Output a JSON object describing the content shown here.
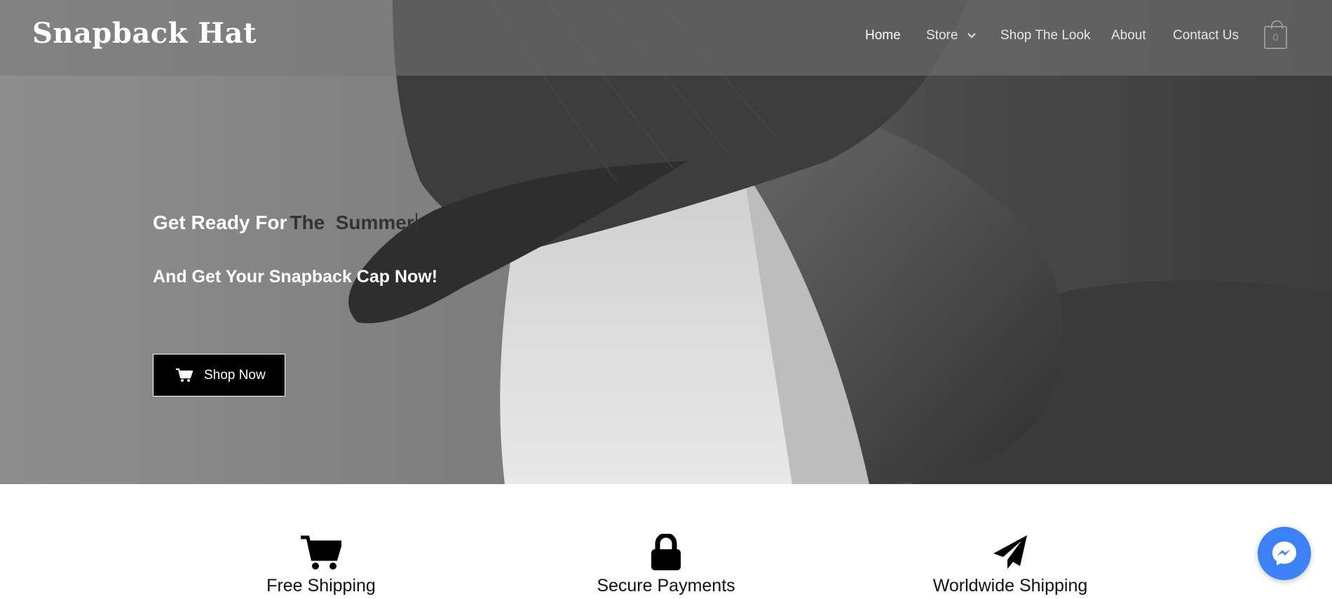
{
  "site": {
    "logo": "Snapback Hat"
  },
  "nav": {
    "items": [
      {
        "label": "Home",
        "active": true
      },
      {
        "label": "Store",
        "has_dropdown": true
      },
      {
        "label": "Shop The Look"
      },
      {
        "label": "About"
      },
      {
        "label": "Contact Us"
      }
    ],
    "cart_count": "0"
  },
  "hero": {
    "headline_static": "Get Ready For",
    "headline_typed": "The  Summer",
    "subheadline": "And Get Your Snapback Cap Now!",
    "cta_label": "Shop Now"
  },
  "features": [
    {
      "icon": "shopping-cart-icon",
      "title": "Free Shipping"
    },
    {
      "icon": "lock-icon",
      "title": "Secure Payments"
    },
    {
      "icon": "paper-plane-icon",
      "title": "Worldwide Shipping"
    }
  ],
  "colors": {
    "header_overlay": "#787878",
    "button_bg": "#000000",
    "messenger": "#3b82f6",
    "text_dark": "#111111"
  }
}
